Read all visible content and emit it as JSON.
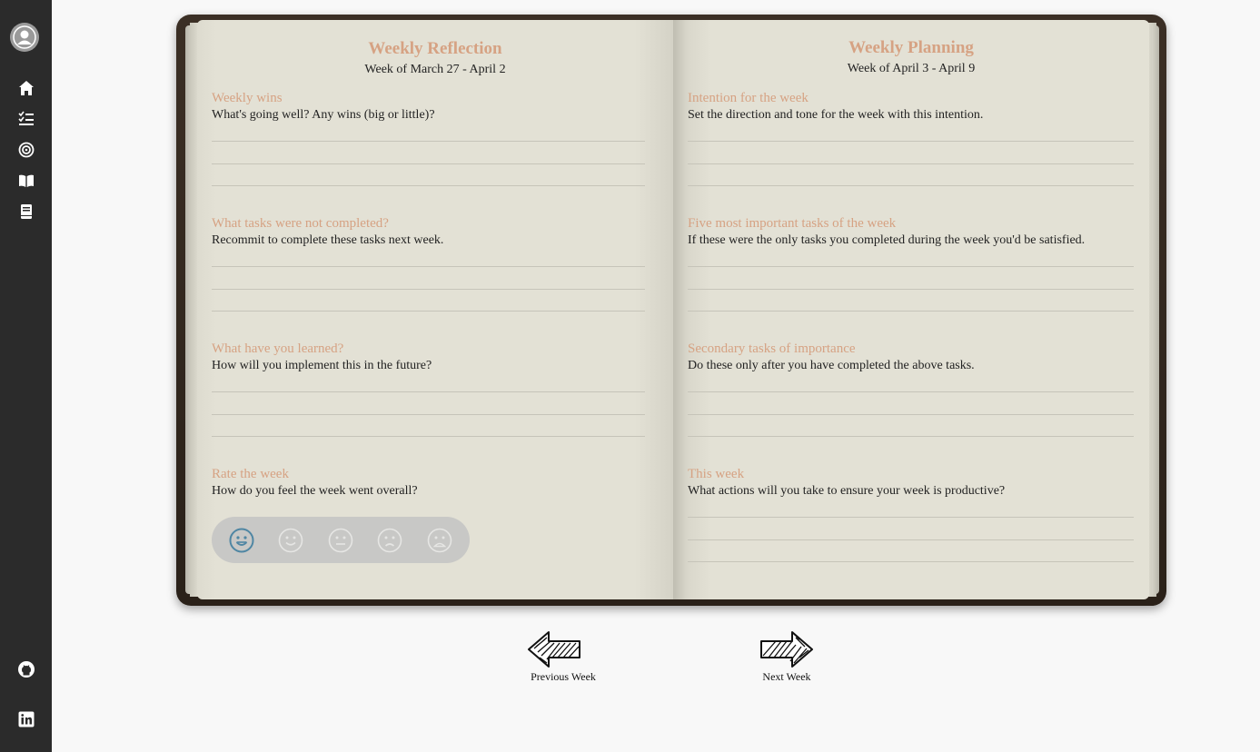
{
  "sidebar": {
    "items": [
      {
        "name": "home",
        "icon": "home-icon"
      },
      {
        "name": "tasks",
        "icon": "checklist-icon"
      },
      {
        "name": "goals",
        "icon": "target-icon"
      },
      {
        "name": "journal",
        "icon": "open-book-icon"
      },
      {
        "name": "notes",
        "icon": "book-icon"
      }
    ],
    "footer": [
      {
        "name": "github",
        "icon": "github-icon"
      },
      {
        "name": "linkedin",
        "icon": "linkedin-icon"
      }
    ]
  },
  "reflection": {
    "title": "Weekly Reflection",
    "week": "Week of March 27 - April 2",
    "sections": [
      {
        "title": "Weekly wins",
        "desc": "What's going well? Any wins (big or little)?"
      },
      {
        "title": "What tasks were not completed?",
        "desc": "Recommit to complete these tasks next week."
      },
      {
        "title": "What have you learned?",
        "desc": "How will you implement this in the future?"
      },
      {
        "title": "Rate the week",
        "desc": "How do you feel the week went overall?"
      }
    ],
    "rating": {
      "faces": [
        "very-happy",
        "happy",
        "neutral",
        "sad",
        "very-sad"
      ],
      "selected": 0
    }
  },
  "planning": {
    "title": "Weekly Planning",
    "week": "Week of April 3 - April 9",
    "sections": [
      {
        "title": "Intention for the week",
        "desc": "Set the direction and tone for the week with this intention."
      },
      {
        "title": "Five most important tasks of the week",
        "desc": "If these were the only tasks you completed during the week you'd be satisfied."
      },
      {
        "title": "Secondary tasks of importance",
        "desc": "Do these only after you have completed the above tasks."
      },
      {
        "title": "This week",
        "desc": "What actions will you take to ensure your week is productive?"
      }
    ]
  },
  "nav": {
    "prev_label": "Previous Week",
    "next_label": "Next Week"
  },
  "colors": {
    "accent": "#d6a283",
    "sidebar": "#2b2b2b",
    "page": "#e2e0d4",
    "selected_face": "#4f86a3"
  }
}
